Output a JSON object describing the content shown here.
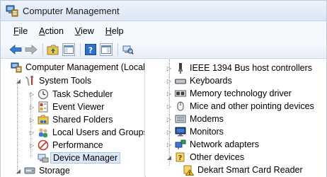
{
  "window": {
    "title": "Computer Management"
  },
  "menu": [
    {
      "label_first": "F",
      "label_rest": "ile"
    },
    {
      "label_first": "A",
      "label_rest": "ction"
    },
    {
      "label_first": "V",
      "label_rest": "iew"
    },
    {
      "label_first": "H",
      "label_rest": "elp"
    }
  ],
  "toolbar": {
    "icons": [
      "back-arrow-icon",
      "forward-arrow-icon",
      "up-folder-icon",
      "show-hide-console-tree-icon",
      "help-icon",
      "properties-icon",
      "scan-hardware-icon"
    ]
  },
  "tree": {
    "root": "Computer Management (Local",
    "system_tools": "System Tools",
    "task_scheduler": "Task Scheduler",
    "event_viewer": "Event Viewer",
    "shared_folders": "Shared Folders",
    "local_users": "Local Users and Groups",
    "performance": "Performance",
    "device_manager": "Device Manager",
    "storage": "Storage"
  },
  "devices": {
    "ieee1394": "IEEE 1394 Bus host controllers",
    "keyboards": "Keyboards",
    "memory": "Memory technology driver",
    "mice": "Mice and other pointing devices",
    "modems": "Modems",
    "monitors": "Monitors",
    "network": "Network adapters",
    "other": "Other devices",
    "dekart": "Dekart Smart Card Reader"
  }
}
